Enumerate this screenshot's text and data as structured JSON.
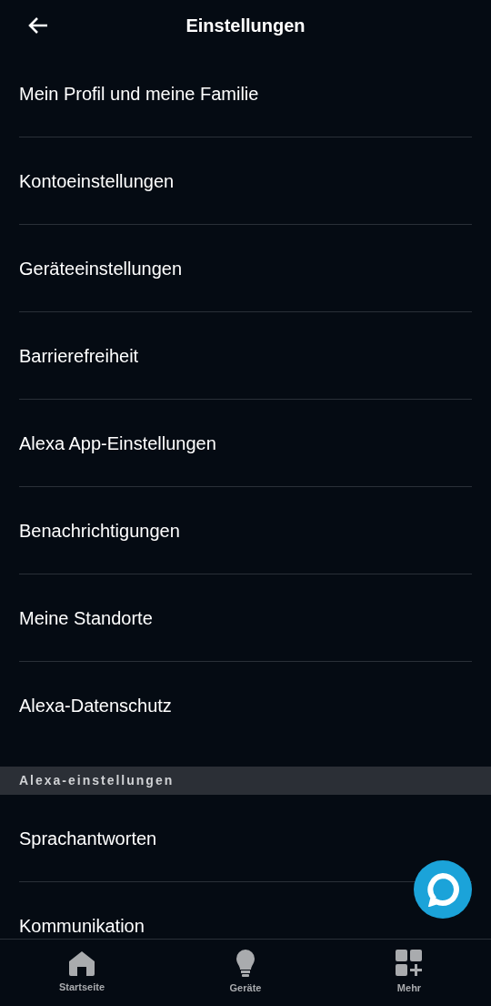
{
  "header": {
    "title": "Einstellungen"
  },
  "items": [
    {
      "label": "Mein Profil und meine Familie"
    },
    {
      "label": "Kontoeinstellungen"
    },
    {
      "label": "Geräteeinstellungen"
    },
    {
      "label": "Barrierefreiheit"
    },
    {
      "label": "Alexa App-Einstellungen"
    },
    {
      "label": "Benachrichtigungen"
    },
    {
      "label": "Meine Standorte"
    },
    {
      "label": "Alexa-Datenschutz"
    }
  ],
  "section": {
    "title": "Alexa-einstellungen",
    "items": [
      {
        "label": "Sprachantworten"
      },
      {
        "label": "Kommunikation"
      }
    ]
  },
  "bottom_nav": [
    {
      "label": "Startseite",
      "kind": "home"
    },
    {
      "label": "Geräte",
      "kind": "devices"
    },
    {
      "label": "Mehr",
      "kind": "more"
    }
  ]
}
